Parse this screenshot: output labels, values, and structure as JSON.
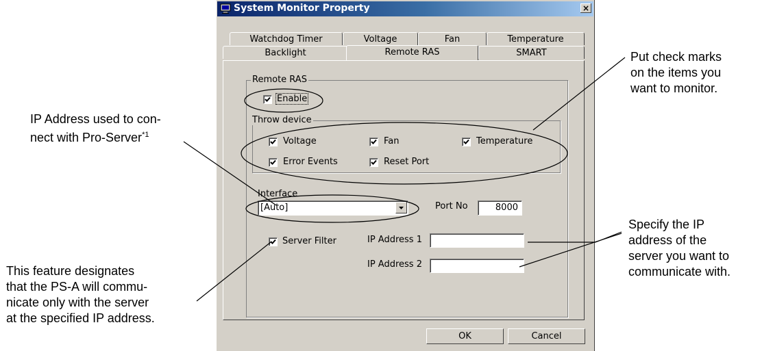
{
  "dialog": {
    "title": "System Monitor Property",
    "close_label": "×",
    "tabs_row1": [
      "Watchdog Timer",
      "Voltage",
      "Fan",
      "Temperature"
    ],
    "tabs_row2": [
      "Backlight",
      "Remote RAS",
      "SMART"
    ],
    "active_tab": "Remote RAS",
    "remote_ras_group": "Remote RAS",
    "enable_label": "Enable",
    "enable_checked": true,
    "throw_device_group": "Throw device",
    "throw_items": [
      {
        "label": "Voltage",
        "checked": true
      },
      {
        "label": "Fan",
        "checked": true
      },
      {
        "label": "Temperature",
        "checked": true
      },
      {
        "label": "Error Events",
        "checked": true
      },
      {
        "label": "Reset Port",
        "checked": true
      }
    ],
    "interface_label": "Interface",
    "interface_value": "[Auto]",
    "port_label": "Port No",
    "port_value": "8000",
    "server_filter_label": "Server Filter",
    "server_filter_checked": true,
    "ip1_label": "IP Address 1",
    "ip1_value": "",
    "ip2_label": "IP Address 2",
    "ip2_value": "",
    "ok_label": "OK",
    "cancel_label": "Cancel"
  },
  "annotations": {
    "ip_address_line1": "IP Address used to con-",
    "ip_address_line2": "nect with Pro-Server",
    "ip_address_footnote": "*1",
    "checkmarks": [
      "Put check marks",
      "on the items you",
      "want to monitor."
    ],
    "specify_ip": [
      "Specify the IP",
      "address of the",
      "server you want to",
      "communicate with."
    ],
    "filter_feature": [
      "This feature designates",
      "that the PS-A will commu-",
      "nicate only with the server",
      "at the specified IP address."
    ]
  }
}
